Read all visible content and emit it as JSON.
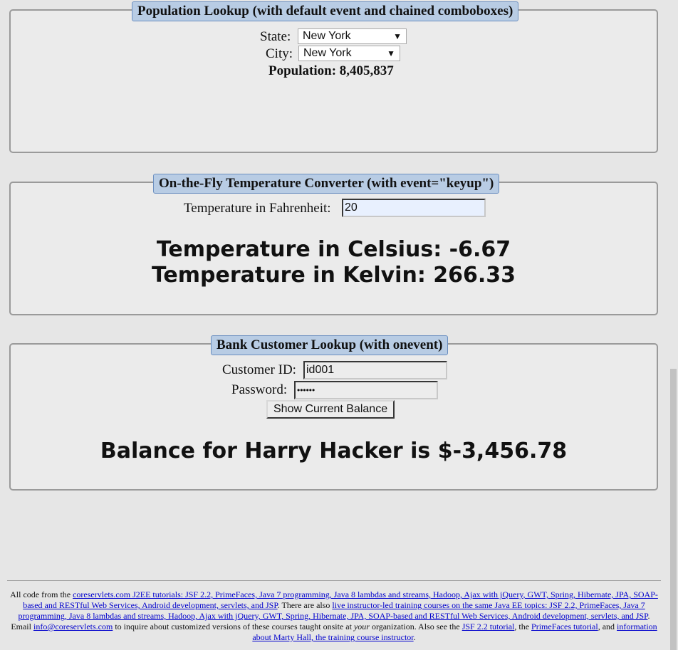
{
  "population": {
    "legend": "Population Lookup (with default event and chained comboboxes)",
    "state_label": "State:",
    "state_value": "New York",
    "city_label": "City:",
    "city_value": "New York",
    "population_text": "Population: 8,405,837"
  },
  "temperature": {
    "legend": "On-the-Fly Temperature Converter (with event=\"keyup\")",
    "fahrenheit_label": "Temperature in Fahrenheit:",
    "fahrenheit_value": "20",
    "celsius_text": "Temperature in Celsius: -6.67",
    "kelvin_text": "Temperature in Kelvin: 266.33"
  },
  "bank": {
    "legend": "Bank Customer Lookup (with onevent)",
    "customer_label": "Customer ID:",
    "customer_value": "id001",
    "password_label": "Password:",
    "password_value": "••••••",
    "button_label": "Show Current Balance",
    "balance_text": "Balance for Harry Hacker is $-3,456.78"
  },
  "footer": {
    "t1": "All code from the ",
    "l1": "coreservlets.com J2EE tutorials: JSF 2.2, PrimeFaces, Java 7 programming, Java 8 lambdas and streams, Hadoop, Ajax with jQuery, GWT, Spring, Hibernate, JPA, SOAP-based and RESTful Web Services, Android development, servlets, and JSP",
    "t2": ". There are also ",
    "l2": "live instructor-led training courses on the same Java EE topics: JSF 2.2, PrimeFaces, Java 7 programming, Java 8 lambdas and streams, Hadoop, Ajax with jQuery, GWT, Spring, Hibernate, JPA, SOAP-based and RESTful Web Services, Android development, servlets, and JSP",
    "t3": ". Email ",
    "l3": "info@coreservlets.com",
    "t4": " to inquire about customized versions of these courses taught onsite at ",
    "t4_em": "your",
    "t5": " organization. Also see the ",
    "l4": "JSF 2.2 tutorial",
    "t6": ", the ",
    "l5": "PrimeFaces tutorial",
    "t7": ", and ",
    "l6": "information about Marty Hall, the training course instructor",
    "t8": "."
  }
}
